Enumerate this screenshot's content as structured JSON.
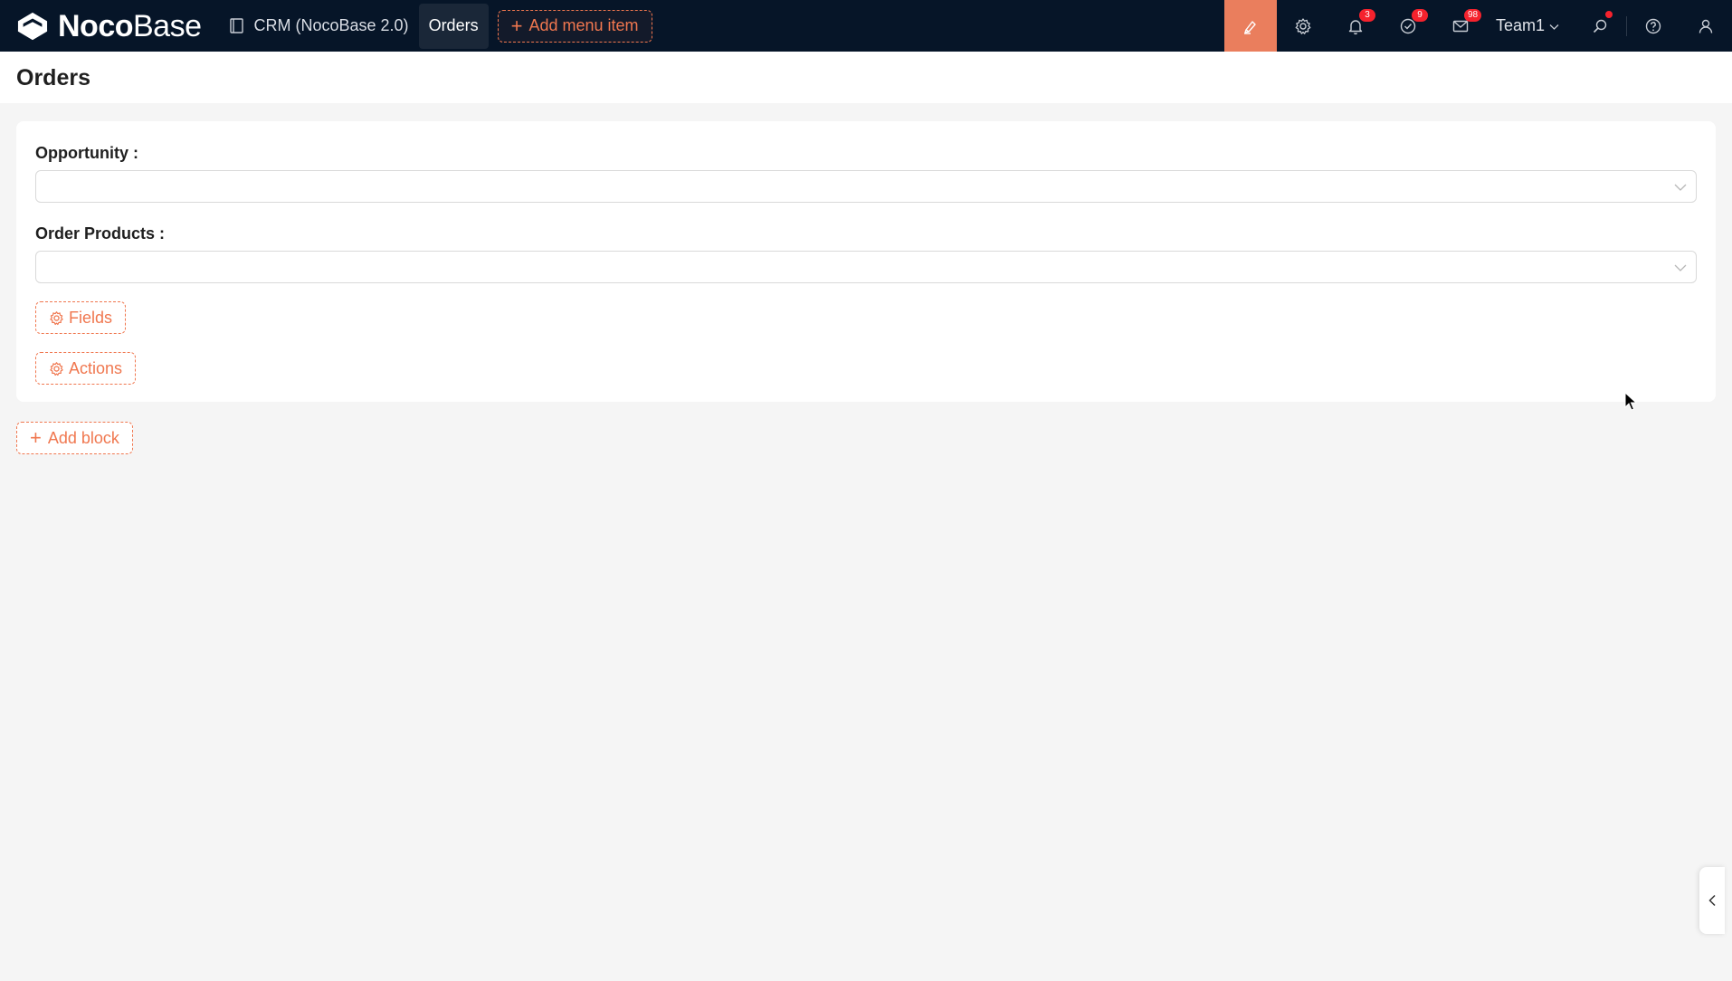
{
  "app": {
    "logo_bold": "Noco",
    "logo_light": "Base"
  },
  "nav": {
    "items": [
      {
        "label": "CRM (NocoBase 2.0)",
        "icon": "file-icon"
      },
      {
        "label": "Orders",
        "active": true
      }
    ],
    "add_menu_label": "Add menu item"
  },
  "toolbar": {
    "design_icon": "highlighter-icon",
    "settings_icon": "gear-icon",
    "notifications_count": "3",
    "tasks_count": "9",
    "messages_count": "98",
    "team_label": "Team1",
    "accent_color": "#ea7e5d",
    "badge_color": "#f5222d"
  },
  "page": {
    "title": "Orders"
  },
  "form": {
    "fields": [
      {
        "label": "Opportunity :",
        "value": ""
      },
      {
        "label": "Order Products :",
        "value": ""
      }
    ],
    "fields_button": "Fields",
    "actions_button": "Actions"
  },
  "add_block_label": "Add block"
}
